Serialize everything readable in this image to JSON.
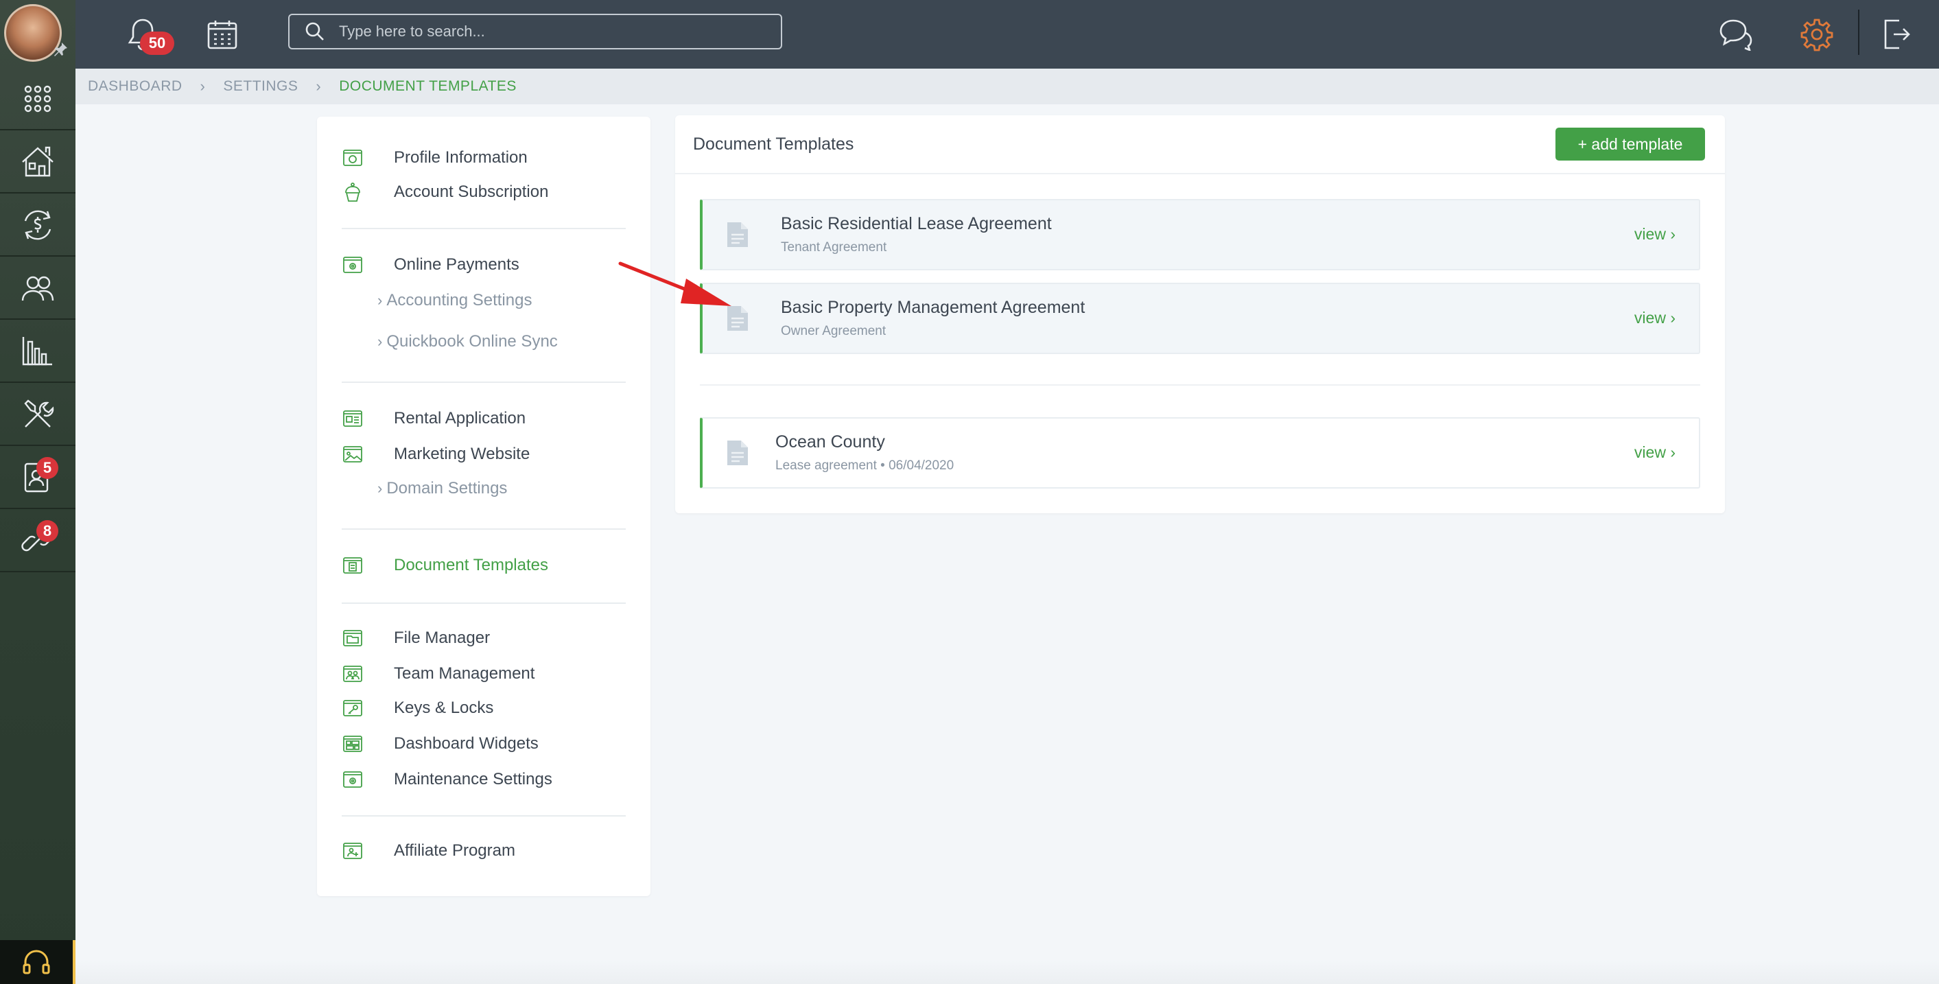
{
  "topbar": {
    "notifications_count": "50",
    "search_placeholder": "Type here to search..."
  },
  "rail": {
    "contacts_badge": "5",
    "links_badge": "8"
  },
  "breadcrumb": {
    "items": [
      "DASHBOARD",
      "SETTINGS",
      "DOCUMENT TEMPLATES"
    ]
  },
  "settings_nav": {
    "profile": "Profile Information",
    "subscription": "Account Subscription",
    "online_payments": "Online Payments",
    "accounting": "Accounting Settings",
    "quickbook": "Quickbook Online Sync",
    "rental_application": "Rental Application",
    "marketing_website": "Marketing Website",
    "domain_settings": "Domain Settings",
    "document_templates": "Document Templates",
    "file_manager": "File Manager",
    "team_management": "Team Management",
    "keys_locks": "Keys & Locks",
    "dashboard_widgets": "Dashboard Widgets",
    "maintenance": "Maintenance Settings",
    "affiliate": "Affiliate Program"
  },
  "templates": {
    "title": "Document Templates",
    "add_label": "+ add template",
    "view_label": "view",
    "rows": [
      {
        "name": "Basic Residential Lease Agreement",
        "sub": "Tenant Agreement"
      },
      {
        "name": "Basic Property Management Agreement",
        "sub": "Owner Agreement"
      },
      {
        "name": "Ocean County",
        "sub": "Lease agreement • 06/04/2020"
      }
    ]
  },
  "colors": {
    "accent_green": "#43a047",
    "topbar_bg": "#3c4752",
    "rail_bg": "#34443a",
    "badge_red": "#d8353b",
    "settings_gear": "#e07a3a",
    "annotation_arrow": "#e02424"
  }
}
